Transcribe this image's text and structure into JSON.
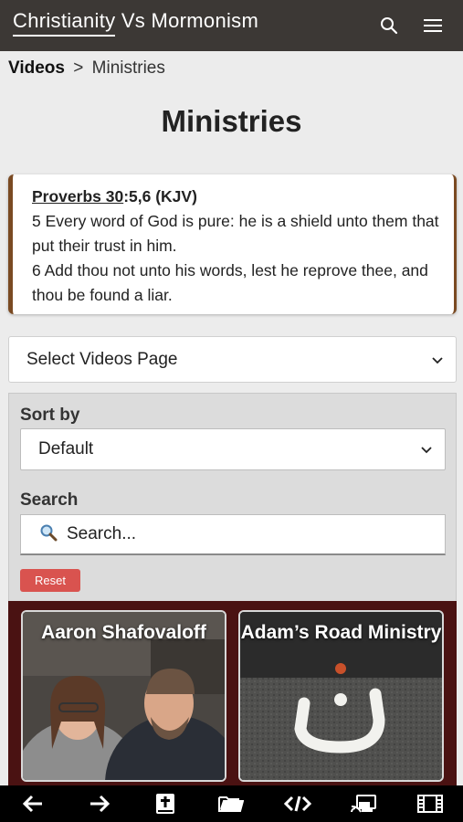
{
  "header": {
    "title": "Christianity Vs Mormonism",
    "search_icon": "search-icon",
    "menu_icon": "menu-icon"
  },
  "breadcrumb": {
    "root": "Videos",
    "separator": ">",
    "current": "Ministries"
  },
  "page": {
    "title": "Ministries"
  },
  "verse": {
    "ref_book": "Proverbs 30",
    "ref_rest": ":5,6 (KJV)",
    "line1": "5 Every word of God is pure: he is a shield unto them that put their trust in him.",
    "line2": "6 Add thou not unto his words, lest he reprove thee, and thou be found a liar.",
    "border_color": "#7a4a22"
  },
  "page_select": {
    "selected": "Select Videos Page"
  },
  "filters": {
    "sort_label": "Sort by",
    "sort_selected": "Default",
    "search_label": "Search",
    "search_placeholder": "Search...",
    "reset_label": "Reset",
    "reset_color": "#d9534f"
  },
  "videos": [
    {
      "title": "Aaron Shafovaloff"
    },
    {
      "title": "Adam’s Road Ministry"
    }
  ],
  "bottom_nav": [
    "back-arrow-icon",
    "forward-arrow-icon",
    "bible-icon",
    "folder-icon",
    "code-icon",
    "cast-icon",
    "film-icon"
  ],
  "colors": {
    "topbar": "#3c3835",
    "video_area": "#4a1212",
    "background": "#ececec"
  }
}
